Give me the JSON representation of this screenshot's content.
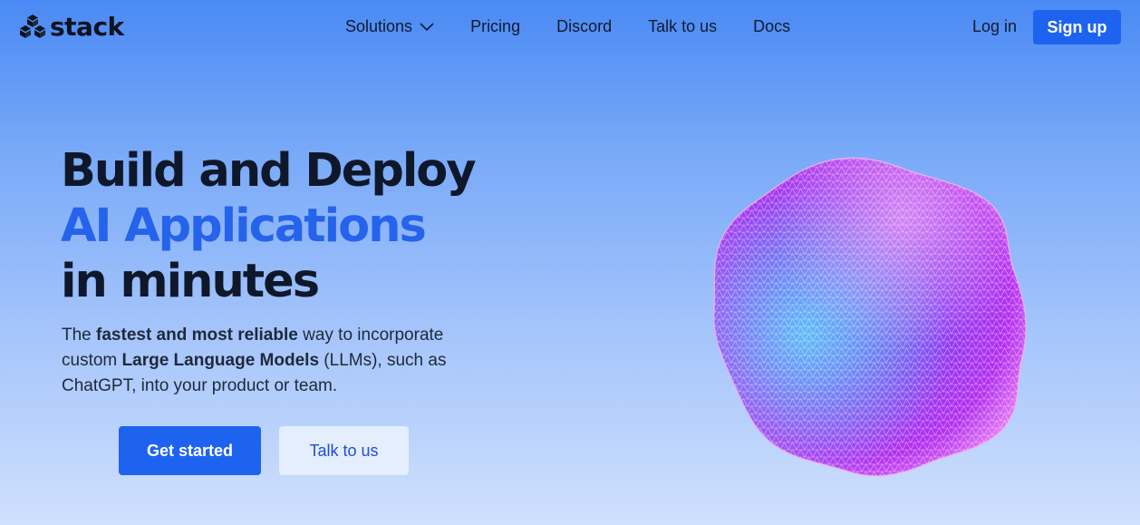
{
  "header": {
    "logo_text": "stack",
    "logo_icon": "stack-cubes-icon",
    "nav": [
      {
        "label": "Solutions",
        "has_dropdown": true
      },
      {
        "label": "Pricing"
      },
      {
        "label": "Discord"
      },
      {
        "label": "Talk to us"
      },
      {
        "label": "Docs"
      }
    ],
    "login_label": "Log in",
    "signup_label": "Sign up"
  },
  "hero": {
    "title_line1": "Build and Deploy",
    "title_line2": "AI Applications",
    "title_line3": "in minutes",
    "desc_pre": "The ",
    "desc_bold1": "fastest and most reliable",
    "desc_mid1": " way to incorporate custom ",
    "desc_bold2": "Large Language Models",
    "desc_post": " (LLMs), such as ChatGPT, into your product or team.",
    "cta_primary": "Get started",
    "cta_secondary": "Talk to us"
  },
  "colors": {
    "accent": "#1d63f0",
    "headline_blue": "#2563eb",
    "text_dark": "#0f172a",
    "blob_purple": "#9b2cf0",
    "blob_cyan": "#38bdf8"
  }
}
